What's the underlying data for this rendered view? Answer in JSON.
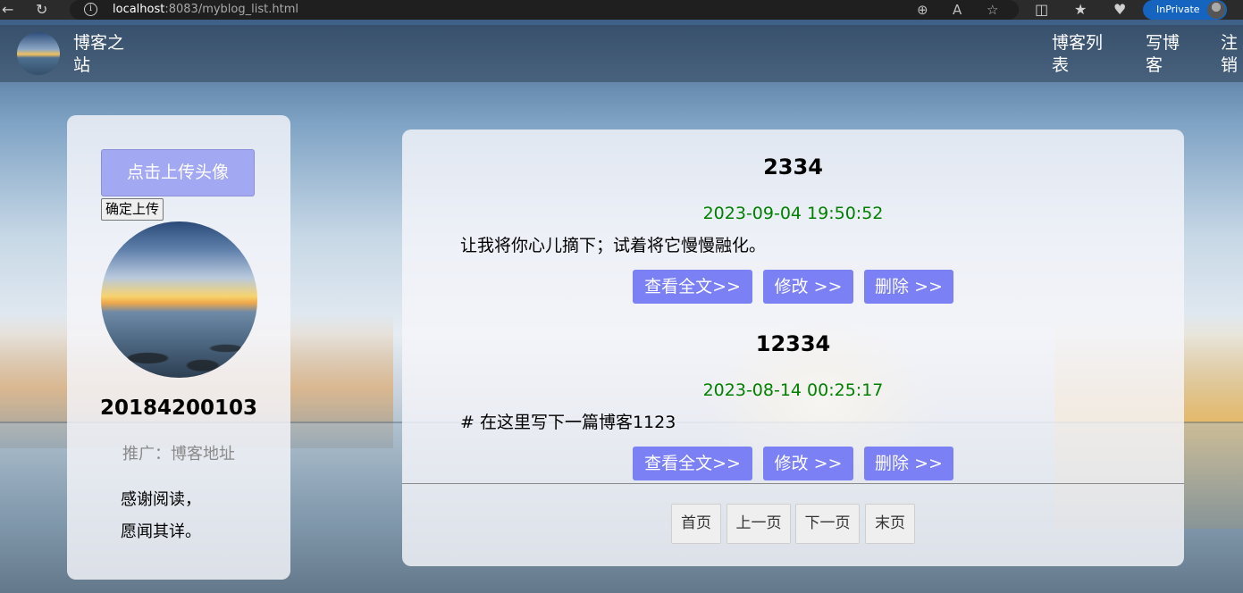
{
  "browser": {
    "url_host": "localhost",
    "url_rest": ":8083/myblog_list.html",
    "inprivate_label": "InPrivate",
    "icons": [
      "back-icon",
      "refresh-icon",
      "info-icon",
      "zoom-icon",
      "read-aloud-icon",
      "favorite-star-icon",
      "split-screen-icon",
      "favorites-icon",
      "health-icon",
      "profile-avatar"
    ]
  },
  "nav": {
    "site_title": "博客之站",
    "links": [
      "博客列表",
      "写博客",
      "注销"
    ]
  },
  "profile": {
    "upload_avatar_label": "点击上传头像",
    "confirm_upload_label": "确定上传",
    "username": "20184200103",
    "promo": "推广：博客地址",
    "thanks_line1": "感谢阅读，",
    "thanks_line2": "愿闻其详。"
  },
  "blogs": [
    {
      "title": "2334",
      "date": "2023-09-04 19:50:52",
      "desc": "让我将你心儿摘下；试着将它慢慢融化。",
      "buttons": [
        "查看全文>>",
        "修改 >>",
        "删除 >>"
      ]
    },
    {
      "title": "12334",
      "date": "2023-08-14 00:25:17",
      "desc": "# 在这里写下一篇博客1123",
      "buttons": [
        "查看全文>>",
        "修改 >>",
        "删除 >>"
      ]
    }
  ],
  "pagination": {
    "first": "首页",
    "prev": "上一页",
    "next": "下一页",
    "last": "末页"
  },
  "colors": {
    "button_primary": "#7b80f4",
    "button_upload": "#a3a8f2",
    "date_green": "#008000",
    "inprivate_blue": "#1565c0"
  }
}
